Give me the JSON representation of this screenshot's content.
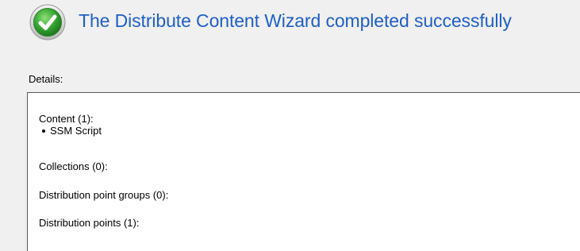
{
  "header": {
    "icon": "success-checkmark-icon",
    "title": "The Distribute Content Wizard completed successfully"
  },
  "details": {
    "label": "Details:",
    "lines": [
      "Content (1):",
      "SSM Script",
      "Collections (0):",
      "Distribution point groups (0):",
      "Distribution points (1):"
    ]
  },
  "colors": {
    "title": "#1f5fc4",
    "icon_green": "#3aa935",
    "background": "#f0f0f0"
  }
}
